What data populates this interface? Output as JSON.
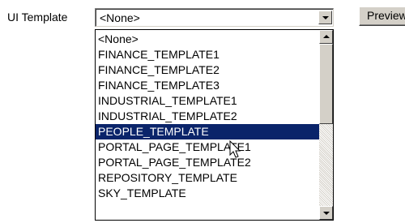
{
  "form": {
    "field_label": "UI Template",
    "select_value": "<None>",
    "preview_label": "Preview"
  },
  "dropdown": {
    "options": [
      {
        "label": "<None>",
        "selected": false
      },
      {
        "label": "FINANCE_TEMPLATE1",
        "selected": false
      },
      {
        "label": "FINANCE_TEMPLATE2",
        "selected": false
      },
      {
        "label": "FINANCE_TEMPLATE3",
        "selected": false
      },
      {
        "label": "INDUSTRIAL_TEMPLATE1",
        "selected": false
      },
      {
        "label": "INDUSTRIAL_TEMPLATE2",
        "selected": false
      },
      {
        "label": "PEOPLE_TEMPLATE",
        "selected": true
      },
      {
        "label": "PORTAL_PAGE_TEMPLATE1",
        "selected": false
      },
      {
        "label": "PORTAL_PAGE_TEMPLATE2",
        "selected": false
      },
      {
        "label": "REPOSITORY_TEMPLATE",
        "selected": false
      },
      {
        "label": "SKY_TEMPLATE",
        "selected": false
      }
    ]
  },
  "colors": {
    "highlight_bg": "#0a246a",
    "highlight_text": "#ffffff",
    "button_face": "#d4d0c8"
  },
  "icons": {
    "select_arrow": "chevron-down-icon",
    "scroll_up": "scroll-up-arrow-icon",
    "scroll_down": "scroll-down-arrow-icon",
    "cursor": "mouse-pointer-icon"
  }
}
